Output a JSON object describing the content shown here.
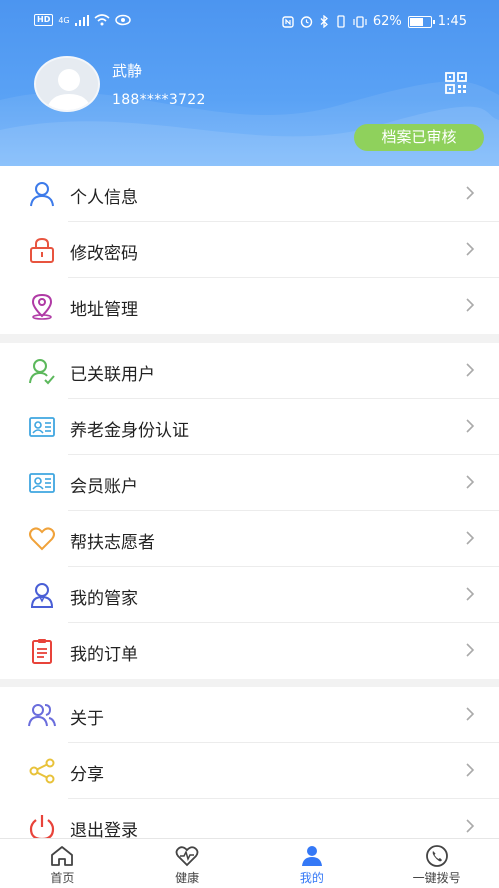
{
  "status_bar": {
    "hd": "HD",
    "network": "4G",
    "battery": "62%",
    "time": "1:45"
  },
  "profile": {
    "name": "武静",
    "phone": "188****3722",
    "badge": "档案已审核"
  },
  "menu_sections": [
    [
      {
        "label": "个人信息",
        "icon": "person-icon",
        "color": "#3d7bea"
      },
      {
        "label": "修改密码",
        "icon": "lock-icon",
        "color": "#e8543f"
      },
      {
        "label": "地址管理",
        "icon": "location-pin-icon",
        "color": "#b03aa5"
      }
    ],
    [
      {
        "label": "已关联用户",
        "icon": "linked-user-icon",
        "color": "#5cb85c"
      },
      {
        "label": "养老金身份认证",
        "icon": "id-card-icon",
        "color": "#3fa6e0"
      },
      {
        "label": "会员账户",
        "icon": "member-card-icon",
        "color": "#3fa6e0"
      },
      {
        "label": "帮扶志愿者",
        "icon": "heart-icon",
        "color": "#f0a23a"
      },
      {
        "label": "我的管家",
        "icon": "butler-icon",
        "color": "#4a5fd6"
      },
      {
        "label": "我的订单",
        "icon": "clipboard-icon",
        "color": "#e8433a"
      }
    ],
    [
      {
        "label": "关于",
        "icon": "group-icon",
        "color": "#6a6ddc"
      },
      {
        "label": "分享",
        "icon": "share-icon",
        "color": "#e8c23a"
      },
      {
        "label": "退出登录",
        "icon": "power-icon",
        "color": "#e8433a"
      }
    ]
  ],
  "tabs": [
    {
      "label": "首页",
      "icon": "home-icon"
    },
    {
      "label": "健康",
      "icon": "heartbeat-icon"
    },
    {
      "label": "我的",
      "icon": "user-icon"
    },
    {
      "label": "一键拨号",
      "icon": "phone-icon"
    }
  ],
  "active_tab": 2,
  "colors": {
    "header": "#4c95f0",
    "badge": "#8fd15c",
    "active_tab": "#3478f6"
  }
}
